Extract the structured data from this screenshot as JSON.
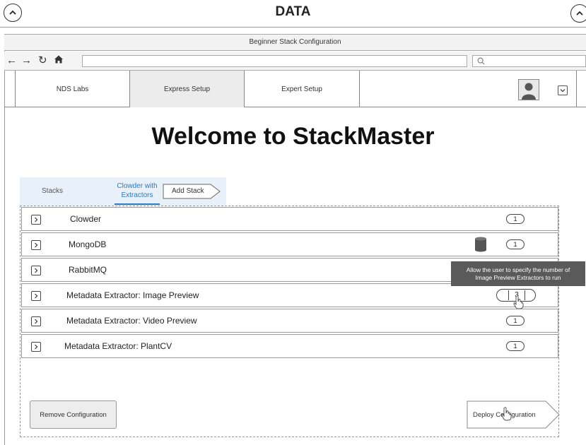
{
  "header": {
    "title": "DATA"
  },
  "window": {
    "title": "Beginner Stack Configuration"
  },
  "browser": {
    "url": "",
    "search_placeholder": ""
  },
  "app_tabs": [
    "NDS Labs",
    "Express Setup",
    "Expert Setup"
  ],
  "page": {
    "heading": "Welcome to StackMaster"
  },
  "stack_tabs": {
    "stacks": "Stacks",
    "active_line1": "Clowder with",
    "active_line2": "Extractors",
    "add": "Add Stack"
  },
  "services": [
    {
      "name": "Clowder",
      "count": "1"
    },
    {
      "name": "MongoDB",
      "count": "1",
      "icon": "database-icon"
    },
    {
      "name": "RabbitMQ",
      "count": ""
    },
    {
      "name": "Metadata Extractor: Image Preview",
      "count": "3"
    },
    {
      "name": "Metadata Extractor: Video Preview",
      "count": "1"
    },
    {
      "name": "Metadata Extractor: PlantCV",
      "count": "1"
    }
  ],
  "tooltip": {
    "line1": "Allow the user to specify the number of",
    "line2": "Image Preview Extractors to run"
  },
  "actions": {
    "remove": "Remove Configuration",
    "deploy": "Deploy Configuration"
  },
  "colors": {
    "accent": "#2a78c8",
    "tooltip_bg": "#5a5a5a",
    "tab_bg": "#e8f1fa"
  }
}
